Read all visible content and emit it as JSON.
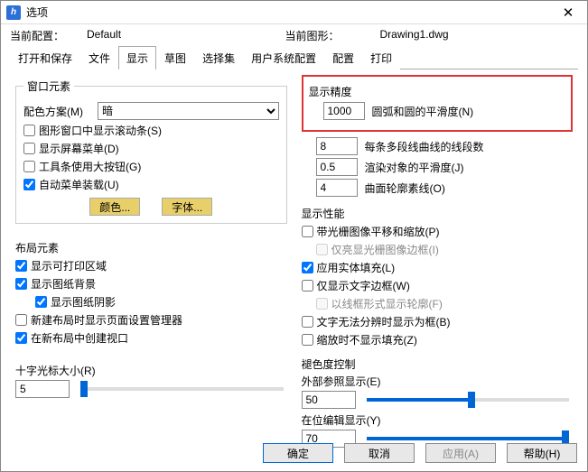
{
  "window": {
    "title": "选项",
    "close": "✕",
    "logo": "h"
  },
  "config": {
    "cur_label": "当前配置：",
    "cur_value": "Default",
    "cur_draw_label": "当前图形：",
    "cur_draw_value": "Drawing1.dwg"
  },
  "tabs": {
    "open_save": "打开和保存",
    "file": "文件",
    "display": "显示",
    "sketch": "草图",
    "selection": "选择集",
    "user_sys": "用户系统配置",
    "config": "配置",
    "print": "打印"
  },
  "left": {
    "window_elem": {
      "legend": "窗口元素",
      "scheme_label": "配色方案(M)",
      "scheme_value": "暗",
      "scrollbar": "图形窗口中显示滚动条(S)",
      "screen_menu": "显示屏幕菜单(D)",
      "large_buttons": "工具条使用大按钮(G)",
      "auto_menu": "自动菜单装载(U)",
      "color_btn": "颜色...",
      "font_btn": "字体..."
    },
    "layout_elem": {
      "legend": "布局元素",
      "printable": "显示可打印区域",
      "paper_bg": "显示图纸背景",
      "paper_shadow": "显示图纸阴影",
      "page_setup": "新建布局时显示页面设置管理器",
      "create_viewport": "在新布局中创建视口"
    },
    "crosshair": {
      "label": "十字光标大小(R)",
      "value": "5"
    }
  },
  "right": {
    "precision": {
      "legend": "显示精度",
      "arc_val": "1000",
      "arc_label": "圆弧和圆的平滑度(N)",
      "seg_val": "8",
      "seg_label": "每条多段线曲线的线段数",
      "render_val": "0.5",
      "render_label": "渲染对象的平滑度(J)",
      "contour_val": "4",
      "contour_label": "曲面轮廓素线(O)"
    },
    "perf": {
      "legend": "显示性能",
      "raster_pan": "带光栅图像平移和缩放(P)",
      "highlight_raster": "仅亮显光栅图像边框(I)",
      "solid_fill": "应用实体填充(L)",
      "text_frame": "仅显示文字边框(W)",
      "wireframe": "以线框形式显示轮廓(F)",
      "text_cannot": "文字无法分辨时显示为框(B)",
      "no_fill_zoom": "缩放时不显示填充(Z)"
    },
    "fade": {
      "legend": "褪色度控制",
      "xref_label": "外部参照显示(E)",
      "xref_val": "50",
      "edit_label": "在位编辑显示(Y)",
      "edit_val": "70"
    }
  },
  "footer": {
    "ok": "确定",
    "cancel": "取消",
    "apply": "应用(A)",
    "help": "帮助(H)"
  }
}
